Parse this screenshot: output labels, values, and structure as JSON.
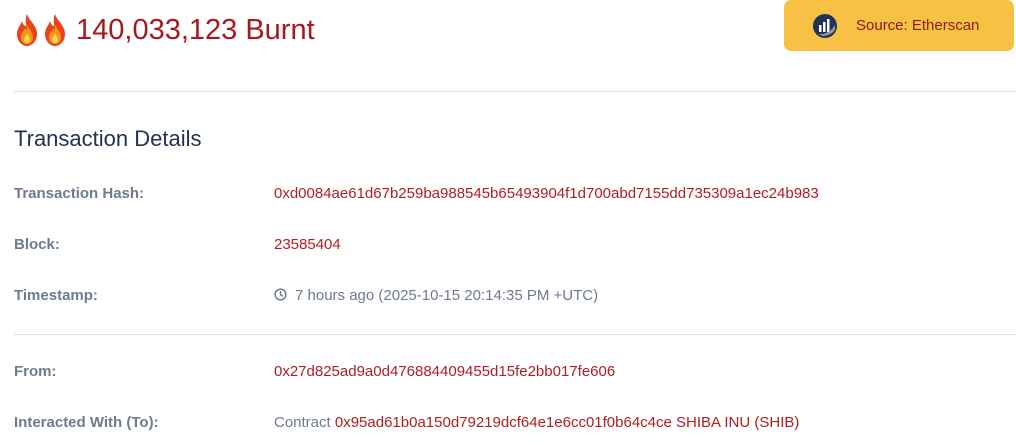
{
  "header": {
    "burnt_text": "140,033,123 Burnt",
    "flame_icons": [
      "fire-icon",
      "fire-icon"
    ]
  },
  "source_button": {
    "label": "Source: Etherscan",
    "icon": "etherscan-logo-icon"
  },
  "section": {
    "title": "Transaction Details"
  },
  "details": {
    "hash_label": "Transaction Hash:",
    "hash_value": "0xd0084ae61d67b259ba988545b65493904f1d700abd7155dd735309a1ec24b983",
    "block_label": "Block:",
    "block_value": "23585404",
    "timestamp_label": "Timestamp:",
    "timestamp_value": "7 hours ago (2025-10-15 20:14:35 PM +UTC)",
    "timestamp_icon": "clock-icon",
    "from_label": "From:",
    "from_value": "0x27d825ad9a0d476884409455d15fe2bb017fe606",
    "to_label": "Interacted With (To):",
    "to_prefix": "Contract",
    "to_value": "0x95ad61b0a150d79219dcf64e1e6cc01f0b64c4ce SHIBA INU (SHIB)"
  },
  "colors": {
    "accent_red": "#a6191c",
    "button_yellow": "#f7c244",
    "label_gray": "#6e7b8e",
    "title_navy": "#23324f"
  }
}
